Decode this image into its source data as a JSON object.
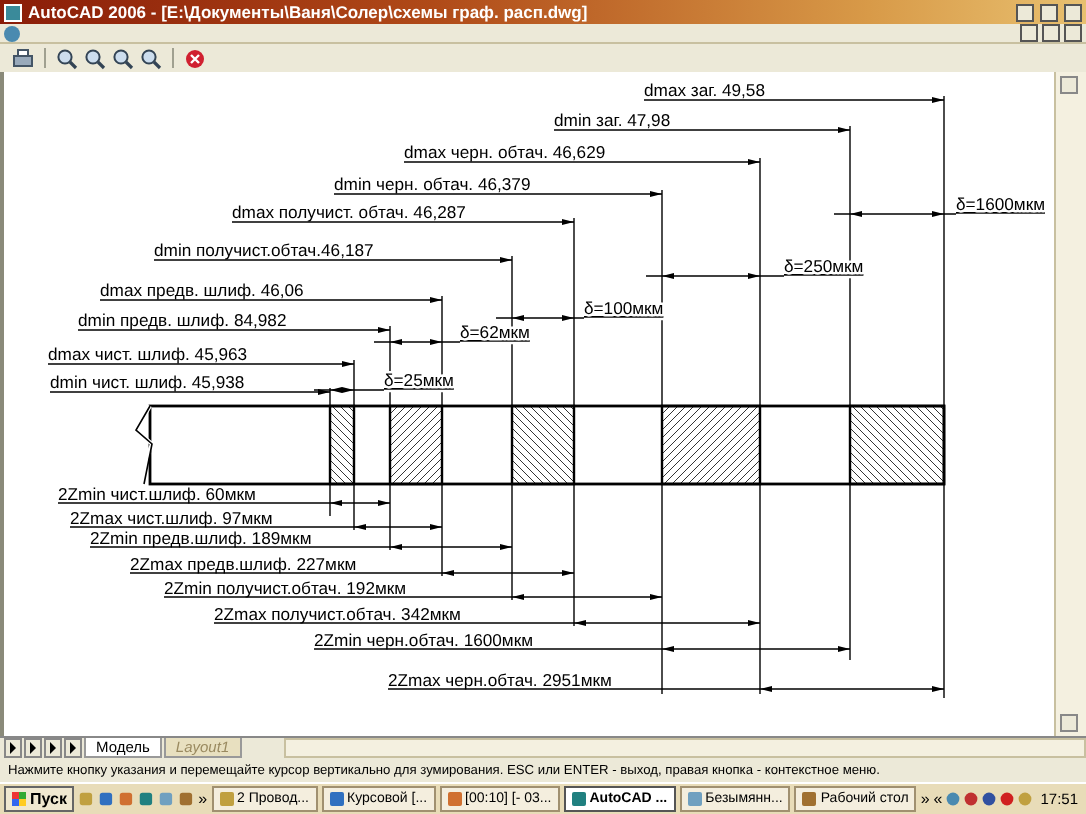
{
  "window": {
    "title": "AutoCAD 2006 - [E:\\Документы\\Ваня\\Солер\\схемы граф. расп.dwg]"
  },
  "drawing": {
    "diameter_labels": [
      {
        "text": "dmax заг. 49,58"
      },
      {
        "text": "dmin заг. 47,98"
      },
      {
        "text": "dmax черн. обтач. 46,629"
      },
      {
        "text": "dmin черн. обтач. 46,379"
      },
      {
        "text": "dmax получист. обтач. 46,287"
      },
      {
        "text": "dmin получист.обтач.46,187"
      },
      {
        "text": "dmax предв. шлиф. 46,06"
      },
      {
        "text": "dmin предв. шлиф. 84,982"
      },
      {
        "text": "dmax чист. шлиф. 45,963"
      },
      {
        "text": "dmin чист. шлиф. 45,938"
      }
    ],
    "tolerance_labels": [
      {
        "text": "δ=1600мкм"
      },
      {
        "text": "δ=250мкм"
      },
      {
        "text": "δ=100мкм"
      },
      {
        "text": "δ=62мкм"
      },
      {
        "text": "δ=25мкм"
      }
    ],
    "allowance_labels": [
      {
        "text": "2Zmin чист.шлиф. 60мкм"
      },
      {
        "text": "2Zmax чист.шлиф. 97мкм"
      },
      {
        "text": "2Zmin предв.шлиф. 189мкм"
      },
      {
        "text": "2Zmax предв.шлиф. 227мкм"
      },
      {
        "text": "2Zmin получист.обтач. 192мкм"
      },
      {
        "text": "2Zmax получист.обтач. 342мкм"
      },
      {
        "text": "2Zmin черн.обтач. 1600мкм"
      },
      {
        "text": "2Zmax черн.обтач. 2951мкм"
      }
    ]
  },
  "layout_tabs": [
    {
      "label": "Модель",
      "selected": true
    },
    {
      "label": "Layout1",
      "selected": false
    }
  ],
  "command_line": "Нажмите кнопку указания и перемещайте курсор вертикально для зумирования. ESC или ENTER - выход, правая кнопка - контекстное меню.",
  "taskbar": {
    "start": "Пуск",
    "more": "»",
    "buttons": [
      {
        "label": "2 Провод...",
        "selected": false
      },
      {
        "label": "Курсовой [...",
        "selected": false
      },
      {
        "label": "[00:10] [- 03...",
        "selected": false
      },
      {
        "label": "AutoCAD ...",
        "selected": true
      },
      {
        "label": "Безымянн...",
        "selected": false
      },
      {
        "label": "Рабочий стол",
        "selected": false
      }
    ],
    "toolbar_more": "»",
    "tray_collapse": "«",
    "clock": "17:51"
  }
}
